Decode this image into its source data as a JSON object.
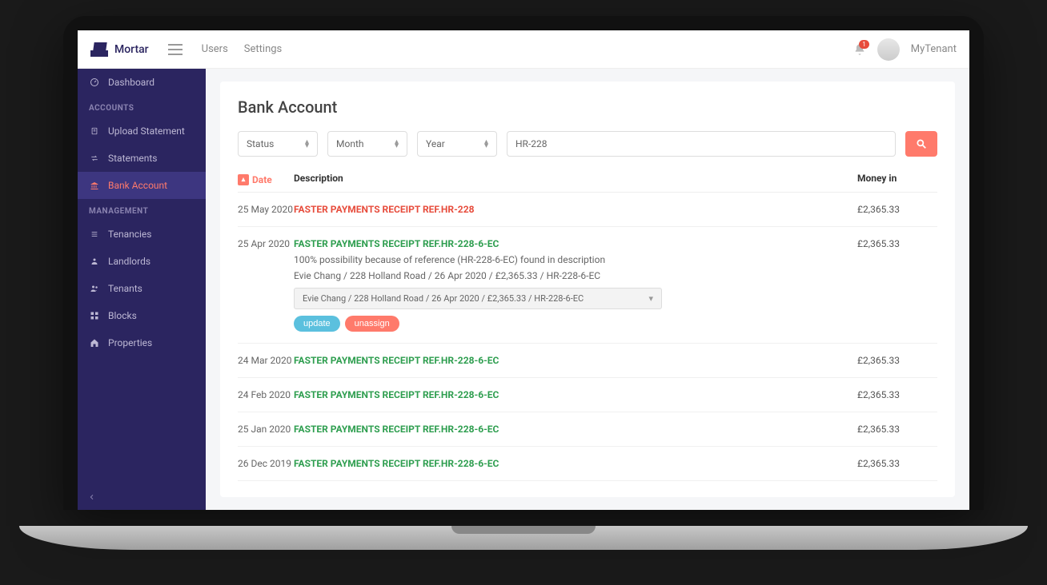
{
  "brand": "Mortar",
  "topnav": {
    "users": "Users",
    "settings": "Settings"
  },
  "notification_count": "1",
  "user": {
    "name": "MyTenant"
  },
  "sidebar": {
    "dashboard": "Dashboard",
    "accounts_header": "ACCOUNTS",
    "upload_statement": "Upload Statement",
    "statements": "Statements",
    "bank_account": "Bank Account",
    "management_header": "MANAGEMENT",
    "tenancies": "Tenancies",
    "landlords": "Landlords",
    "tenants": "Tenants",
    "blocks": "Blocks",
    "properties": "Properties"
  },
  "page": {
    "title": "Bank Account"
  },
  "filters": {
    "status": "Status",
    "month": "Month",
    "year": "Year",
    "search_value": "HR-228"
  },
  "columns": {
    "date": "Date",
    "description": "Description",
    "money_in": "Money in"
  },
  "rows": [
    {
      "date": "25 May 2020",
      "title": "FASTER PAYMENTS RECEIPT REF.HR-228",
      "color": "red",
      "money": "£2,365.33"
    },
    {
      "date": "25 Apr 2020",
      "title": "FASTER PAYMENTS RECEIPT REF.HR-228-6-EC",
      "color": "green",
      "money": "£2,365.33",
      "sub": "100% possibility because of reference (HR-228-6-EC) found in description",
      "match": "Evie Chang / 228 Holland Road / 26 Apr 2020 / £2,365.33 / HR-228-6-EC",
      "select": "Evie Chang / 228 Holland Road / 26 Apr 2020 / £2,365.33 / HR-228-6-EC",
      "update": "update",
      "unassign": "unassign"
    },
    {
      "date": "24 Mar 2020",
      "title": "FASTER PAYMENTS RECEIPT REF.HR-228-6-EC",
      "color": "green",
      "money": "£2,365.33"
    },
    {
      "date": "24 Feb 2020",
      "title": "FASTER PAYMENTS RECEIPT REF.HR-228-6-EC",
      "color": "green",
      "money": "£2,365.33"
    },
    {
      "date": "25 Jan 2020",
      "title": "FASTER PAYMENTS RECEIPT REF.HR-228-6-EC",
      "color": "green",
      "money": "£2,365.33"
    },
    {
      "date": "26 Dec 2019",
      "title": "FASTER PAYMENTS RECEIPT REF.HR-228-6-EC",
      "color": "green",
      "money": "£2,365.33"
    }
  ]
}
